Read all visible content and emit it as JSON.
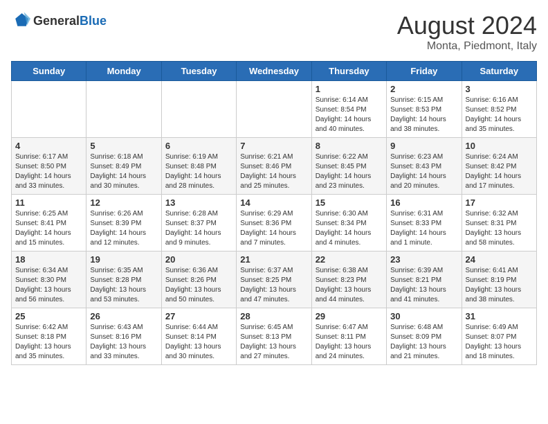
{
  "header": {
    "logo_general": "General",
    "logo_blue": "Blue",
    "title": "August 2024",
    "subtitle": "Monta, Piedmont, Italy"
  },
  "days_of_week": [
    "Sunday",
    "Monday",
    "Tuesday",
    "Wednesday",
    "Thursday",
    "Friday",
    "Saturday"
  ],
  "weeks": [
    [
      {
        "day": "",
        "info": ""
      },
      {
        "day": "",
        "info": ""
      },
      {
        "day": "",
        "info": ""
      },
      {
        "day": "",
        "info": ""
      },
      {
        "day": "1",
        "info": "Sunrise: 6:14 AM\nSunset: 8:54 PM\nDaylight: 14 hours and 40 minutes."
      },
      {
        "day": "2",
        "info": "Sunrise: 6:15 AM\nSunset: 8:53 PM\nDaylight: 14 hours and 38 minutes."
      },
      {
        "day": "3",
        "info": "Sunrise: 6:16 AM\nSunset: 8:52 PM\nDaylight: 14 hours and 35 minutes."
      }
    ],
    [
      {
        "day": "4",
        "info": "Sunrise: 6:17 AM\nSunset: 8:50 PM\nDaylight: 14 hours and 33 minutes."
      },
      {
        "day": "5",
        "info": "Sunrise: 6:18 AM\nSunset: 8:49 PM\nDaylight: 14 hours and 30 minutes."
      },
      {
        "day": "6",
        "info": "Sunrise: 6:19 AM\nSunset: 8:48 PM\nDaylight: 14 hours and 28 minutes."
      },
      {
        "day": "7",
        "info": "Sunrise: 6:21 AM\nSunset: 8:46 PM\nDaylight: 14 hours and 25 minutes."
      },
      {
        "day": "8",
        "info": "Sunrise: 6:22 AM\nSunset: 8:45 PM\nDaylight: 14 hours and 23 minutes."
      },
      {
        "day": "9",
        "info": "Sunrise: 6:23 AM\nSunset: 8:43 PM\nDaylight: 14 hours and 20 minutes."
      },
      {
        "day": "10",
        "info": "Sunrise: 6:24 AM\nSunset: 8:42 PM\nDaylight: 14 hours and 17 minutes."
      }
    ],
    [
      {
        "day": "11",
        "info": "Sunrise: 6:25 AM\nSunset: 8:41 PM\nDaylight: 14 hours and 15 minutes."
      },
      {
        "day": "12",
        "info": "Sunrise: 6:26 AM\nSunset: 8:39 PM\nDaylight: 14 hours and 12 minutes."
      },
      {
        "day": "13",
        "info": "Sunrise: 6:28 AM\nSunset: 8:37 PM\nDaylight: 14 hours and 9 minutes."
      },
      {
        "day": "14",
        "info": "Sunrise: 6:29 AM\nSunset: 8:36 PM\nDaylight: 14 hours and 7 minutes."
      },
      {
        "day": "15",
        "info": "Sunrise: 6:30 AM\nSunset: 8:34 PM\nDaylight: 14 hours and 4 minutes."
      },
      {
        "day": "16",
        "info": "Sunrise: 6:31 AM\nSunset: 8:33 PM\nDaylight: 14 hours and 1 minute."
      },
      {
        "day": "17",
        "info": "Sunrise: 6:32 AM\nSunset: 8:31 PM\nDaylight: 13 hours and 58 minutes."
      }
    ],
    [
      {
        "day": "18",
        "info": "Sunrise: 6:34 AM\nSunset: 8:30 PM\nDaylight: 13 hours and 56 minutes."
      },
      {
        "day": "19",
        "info": "Sunrise: 6:35 AM\nSunset: 8:28 PM\nDaylight: 13 hours and 53 minutes."
      },
      {
        "day": "20",
        "info": "Sunrise: 6:36 AM\nSunset: 8:26 PM\nDaylight: 13 hours and 50 minutes."
      },
      {
        "day": "21",
        "info": "Sunrise: 6:37 AM\nSunset: 8:25 PM\nDaylight: 13 hours and 47 minutes."
      },
      {
        "day": "22",
        "info": "Sunrise: 6:38 AM\nSunset: 8:23 PM\nDaylight: 13 hours and 44 minutes."
      },
      {
        "day": "23",
        "info": "Sunrise: 6:39 AM\nSunset: 8:21 PM\nDaylight: 13 hours and 41 minutes."
      },
      {
        "day": "24",
        "info": "Sunrise: 6:41 AM\nSunset: 8:19 PM\nDaylight: 13 hours and 38 minutes."
      }
    ],
    [
      {
        "day": "25",
        "info": "Sunrise: 6:42 AM\nSunset: 8:18 PM\nDaylight: 13 hours and 35 minutes."
      },
      {
        "day": "26",
        "info": "Sunrise: 6:43 AM\nSunset: 8:16 PM\nDaylight: 13 hours and 33 minutes."
      },
      {
        "day": "27",
        "info": "Sunrise: 6:44 AM\nSunset: 8:14 PM\nDaylight: 13 hours and 30 minutes."
      },
      {
        "day": "28",
        "info": "Sunrise: 6:45 AM\nSunset: 8:13 PM\nDaylight: 13 hours and 27 minutes."
      },
      {
        "day": "29",
        "info": "Sunrise: 6:47 AM\nSunset: 8:11 PM\nDaylight: 13 hours and 24 minutes."
      },
      {
        "day": "30",
        "info": "Sunrise: 6:48 AM\nSunset: 8:09 PM\nDaylight: 13 hours and 21 minutes."
      },
      {
        "day": "31",
        "info": "Sunrise: 6:49 AM\nSunset: 8:07 PM\nDaylight: 13 hours and 18 minutes."
      }
    ]
  ]
}
